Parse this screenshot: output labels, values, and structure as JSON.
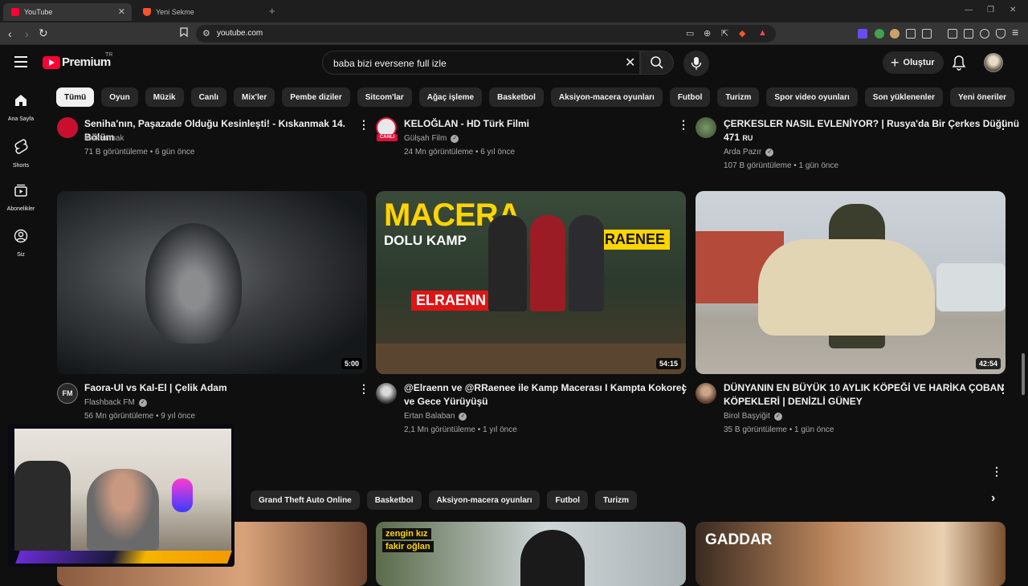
{
  "browser": {
    "tabs": [
      {
        "title": "YouTube"
      },
      {
        "title": "Yeni Sekme"
      }
    ],
    "url": "youtube.com"
  },
  "header": {
    "logo_text": "Premium",
    "country_code": "TR",
    "search_query": "baba bizi eversene full izle",
    "create_label": "Oluştur"
  },
  "chips": [
    "Tümü",
    "Oyun",
    "Müzik",
    "Canlı",
    "Mix'ler",
    "Pembe diziler",
    "Sitcom'lar",
    "Ağaç işleme",
    "Basketbol",
    "Aksiyon-macera oyunları",
    "Futbol",
    "Turizm",
    "Spor video oyunları",
    "Son yüklenenler",
    "Yeni öneriler"
  ],
  "sidenav": [
    {
      "label": "Ana Sayfa",
      "icon": "home-icon"
    },
    {
      "label": "Shorts",
      "icon": "shorts-icon"
    },
    {
      "label": "Abonelikler",
      "icon": "subscriptions-icon"
    },
    {
      "label": "Siz",
      "icon": "you-icon"
    }
  ],
  "row1": [
    {
      "title": "Seniha'nın, Paşazade Olduğu Kesinleşti! - Kıskanmak 14. Bölüm",
      "channel": "Kıskanmak",
      "stats": "71 B görüntüleme • 6 gün önce"
    },
    {
      "title": "KELOĞLAN - HD Türk Filmi",
      "channel": "Gülşah Film",
      "stats": "24 Mn görüntüleme • 6 yıl önce",
      "avatar_badge": "CANLI"
    },
    {
      "title_line1": "ÇERKESLER NASIL EVLENİYOR? | Rusya'da Bir Çerkes Düğünü",
      "title_line2": "471",
      "title_suffix": "RU",
      "channel": "Arda Pazır",
      "stats": "107 B görüntüleme • 1 gün önce"
    }
  ],
  "row2": [
    {
      "title": "Faora-Ul vs Kal-El | Çelik Adam",
      "channel": "Flashback FM",
      "stats": "56 Mn görüntüleme • 9 yıl önce",
      "duration": "5:00",
      "avatar_text": "FM"
    },
    {
      "title_line1": "@Elraenn ve @RRaenee  ile Kamp Macerası I Kampta Kokoreç",
      "title_line2": "ve Gece Yürüyüşü",
      "channel": "Ertan Balaban",
      "stats": "2,1 Mn görüntüleme • 1 yıl önce",
      "duration": "54:15",
      "thumb_text": {
        "big": "MACERA",
        "sub": "DOLU KAMP",
        "name1": "ELRAENN",
        "name2": "RRAENEE"
      }
    },
    {
      "title_line1": "DÜNYANIN EN BÜYÜK 10 AYLIK KÖPEĞİ VE HARİKA ÇOBAN",
      "title_line2": "KÖPEKLERİ | DENİZLİ GÜNEY",
      "channel": "Birol Başyiğit",
      "stats": "35 B görüntüleme • 1 gün önce",
      "duration": "42:54"
    }
  ],
  "section_chips": [
    "Grand Theft Auto Online",
    "Basketbol",
    "Aksiyon-macera oyunları",
    "Futbol",
    "Turizm"
  ],
  "row3": [
    {
      "thumb_text": ""
    },
    {
      "thumb_text_line1": "zengin kız",
      "thumb_text_line2": "fakir oğlan"
    },
    {
      "thumb_text": "GADDAR"
    }
  ]
}
